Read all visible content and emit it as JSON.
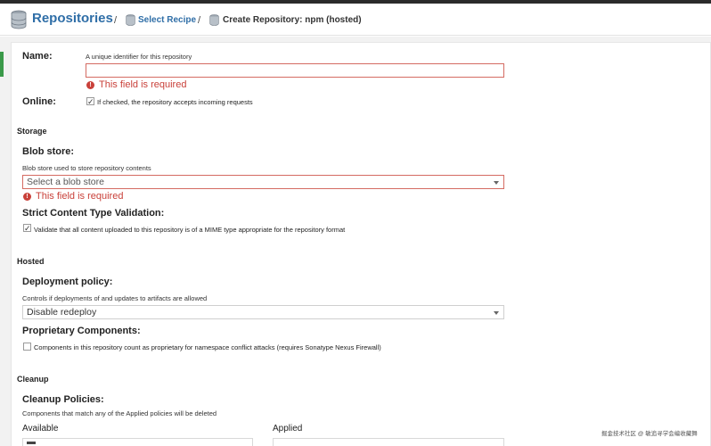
{
  "header": {
    "title": "Repositories",
    "crumb_sep": "/",
    "select_recipe": "Select Recipe",
    "current": "Create Repository: npm (hosted)"
  },
  "form": {
    "name_label": "Name:",
    "name_help": "A unique identifier for this repository",
    "name_value": "",
    "name_error": "This field is required",
    "online_label": "Online:",
    "online_checked": true,
    "online_text": "If checked, the repository accepts incoming requests",
    "storage_section": "Storage",
    "blob_label": "Blob store:",
    "blob_help": "Blob store used to store repository contents",
    "blob_placeholder": "Select a blob store",
    "blob_error": "This field is required",
    "strict_label": "Strict Content Type Validation:",
    "strict_checked": true,
    "strict_text": "Validate that all content uploaded to this repository is of a MIME type appropriate for the repository format",
    "hosted_section": "Hosted",
    "deploy_label": "Deployment policy:",
    "deploy_help": "Controls if deployments of and updates to artifacts are allowed",
    "deploy_value": "Disable redeploy",
    "proprietary_label": "Proprietary Components:",
    "proprietary_checked": false,
    "proprietary_text": "Components in this repository count as proprietary for namespace conflict attacks (requires Sonatype Nexus Firewall)",
    "cleanup_section": "Cleanup",
    "cleanup_label": "Cleanup Policies:",
    "cleanup_help": "Components that match any of the Applied policies will be deleted",
    "available_label": "Available",
    "applied_label": "Applied"
  },
  "checkmark": "✓",
  "error_icon": "!",
  "watermark": "掘金技术社区 @ 敏追寻学会编收藏舞",
  "colors": {
    "brand": "#2f6ea7",
    "error": "#c9413a",
    "accent_green": "#3b9a4a"
  }
}
